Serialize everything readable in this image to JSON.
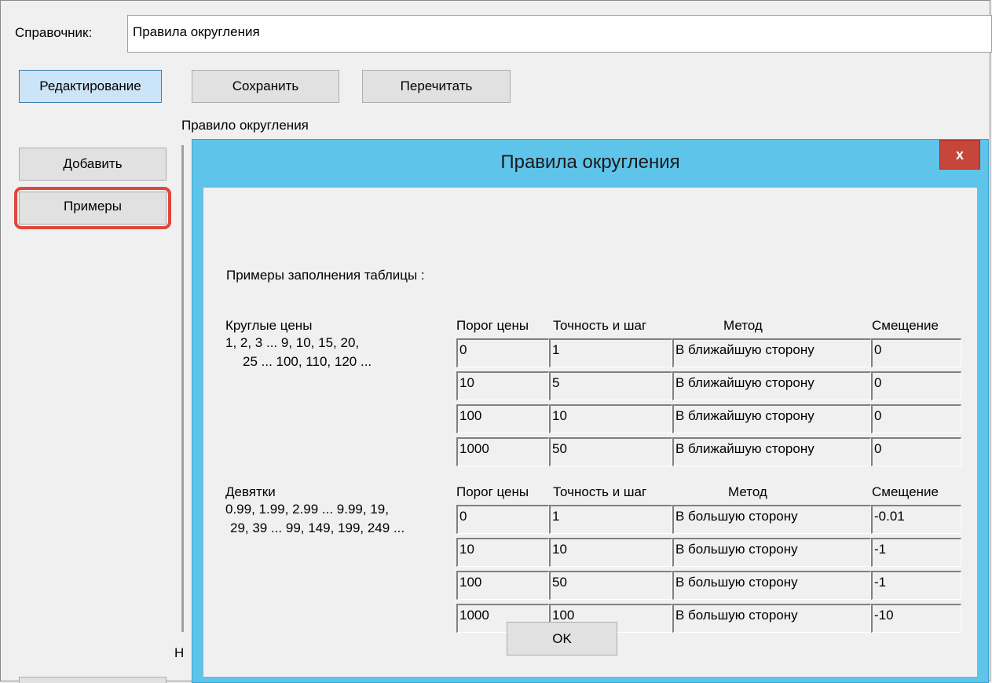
{
  "main": {
    "directory_label": "Справочник:",
    "directory_value": "Правила округления",
    "edit_button": "Редактирование",
    "save_button": "Сохранить",
    "reload_button": "Перечитать",
    "rule_label": "Правило округления",
    "add_button": "Добавить",
    "examples_button": "Примеры",
    "partial_label": "Н"
  },
  "dialog": {
    "title": "Правила округления",
    "close_label": "x",
    "intro": "Примеры заполнения таблицы :",
    "headers": {
      "threshold": "Порог цены",
      "precision": "Точность и шаг",
      "method": "Метод",
      "offset": "Смещение"
    },
    "groups": [
      {
        "name": "Круглые цены",
        "desc1": "1, 2, 3 ... 9, 10, 15, 20,",
        "desc2": "25 ... 100, 110, 120 ...",
        "rows": [
          {
            "threshold": "0",
            "precision": "1",
            "method": "В ближайшую сторону",
            "offset": "0"
          },
          {
            "threshold": "10",
            "precision": "5",
            "method": "В ближайшую сторону",
            "offset": "0"
          },
          {
            "threshold": "100",
            "precision": "10",
            "method": "В ближайшую сторону",
            "offset": "0"
          },
          {
            "threshold": "1000",
            "precision": "50",
            "method": "В ближайшую сторону",
            "offset": "0"
          }
        ]
      },
      {
        "name": "Девятки",
        "desc1": "0.99, 1.99, 2.99 ... 9.99, 19,",
        "desc2": "29, 39 ... 99, 149, 199, 249 ...",
        "rows": [
          {
            "threshold": "0",
            "precision": "1",
            "method": "В большую сторону",
            "offset": "-0.01"
          },
          {
            "threshold": "10",
            "precision": "10",
            "method": "В большую сторону",
            "offset": "-1"
          },
          {
            "threshold": "100",
            "precision": "50",
            "method": "В большую сторону",
            "offset": "-1"
          },
          {
            "threshold": "1000",
            "precision": "100",
            "method": "В большую сторону",
            "offset": "-10"
          }
        ]
      }
    ],
    "ok_button": "OK"
  },
  "colors": {
    "dialog_frame": "#5ec4ea",
    "close_button": "#c6463b",
    "highlight": "#e0463a",
    "active_button": "#cce4f7"
  }
}
